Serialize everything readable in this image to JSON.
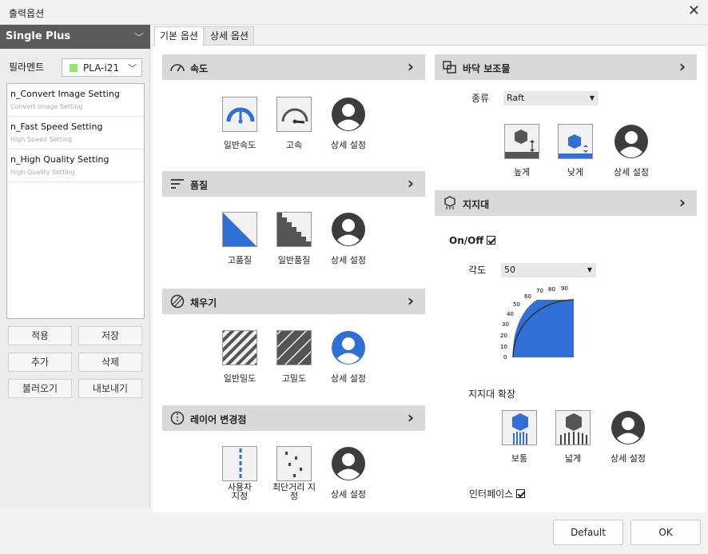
{
  "window": {
    "title": "출력옵션"
  },
  "left": {
    "printer": "Single Plus",
    "filament_label": "필라멘트",
    "filament_value": "PLA-i21",
    "filament_color": "#8bea6e",
    "profiles": [
      {
        "title": "n_Convert Image Setting",
        "subtitle": "Convert Image Setting"
      },
      {
        "title": "n_Fast Speed Setting",
        "subtitle": "High Speed Setting"
      },
      {
        "title": "n_High Quality Setting",
        "subtitle": "High Quality Setting"
      }
    ],
    "buttons": {
      "apply": "적용",
      "save": "저장",
      "add": "추가",
      "delete": "삭제",
      "load": "불러오기",
      "export": "내보내기"
    }
  },
  "tabs": {
    "basic": "기본 옵션",
    "detail": "상세 옵션"
  },
  "speed": {
    "title": "속도",
    "options": [
      "일반속도",
      "고속",
      "상세 설정"
    ]
  },
  "quality": {
    "title": "품질",
    "options": [
      "고품질",
      "일반품질",
      "상세 설정"
    ]
  },
  "infill": {
    "title": "채우기",
    "options": [
      "일반밀도",
      "고밀도",
      "상세 설정"
    ]
  },
  "layer": {
    "title": "레이어 변경점",
    "options": [
      "사용자\n지정",
      "최단거리 지\n정",
      "상세 설정"
    ]
  },
  "raft": {
    "title": "바닥 보조물",
    "type_label": "종류",
    "type_value": "Raft",
    "options": [
      "높게",
      "낮게",
      "상세 설정"
    ]
  },
  "support": {
    "title": "지지대",
    "onoff_label": "On/Off",
    "angle_label": "각도",
    "angle_value": "50",
    "gauge_ticks": [
      "0",
      "10",
      "20",
      "30",
      "40",
      "50",
      "60",
      "70",
      "80",
      "90"
    ],
    "expand_label": "지지대 확장",
    "expand_options": [
      "보통",
      "넓게",
      "상세 설정"
    ],
    "interface_label": "인터페이스"
  },
  "footer": {
    "default": "Default",
    "ok": "OK"
  },
  "colors": {
    "accent_blue": "#2f6fd6",
    "header_gray": "#d9d9d9"
  }
}
